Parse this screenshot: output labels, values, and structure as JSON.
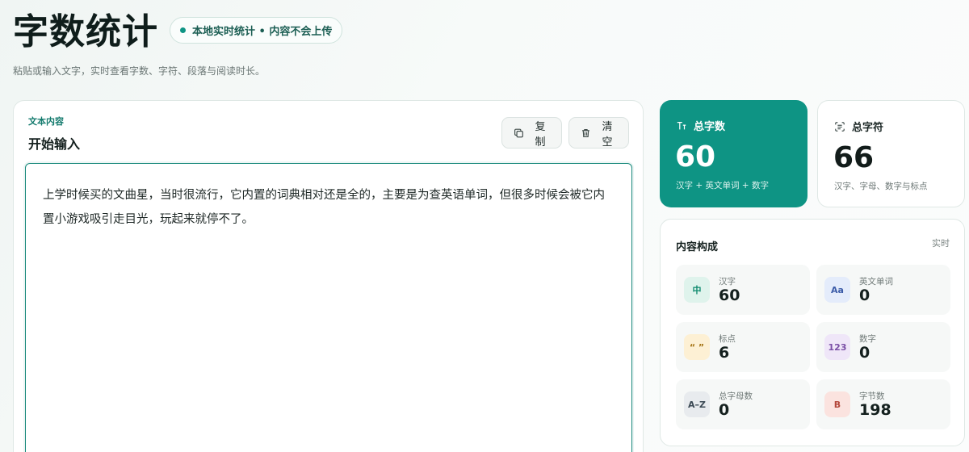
{
  "header": {
    "title": "字数统计",
    "badge": "本地实时统计 • 内容不会上传",
    "subtitle": "粘贴或输入文字，实时查看字数、字符、段落与阅读时长。"
  },
  "editor": {
    "eyebrow": "文本内容",
    "heading": "开始输入",
    "copy_label": "复制",
    "clear_label": "清空",
    "text": "上学时候买的文曲星，当时很流行，它内置的词典相对还是全的，主要是为查英语单词，但很多时候会被它内置小游戏吸引走目光，玩起来就停不了。"
  },
  "stats": {
    "total_chars": {
      "label": "总字数",
      "value": "60",
      "desc": "汉字 + 英文单词 + 数字"
    },
    "total_symbols": {
      "label": "总字符",
      "value": "66",
      "desc": "汉字、字母、数字与标点"
    }
  },
  "composition": {
    "title": "内容构成",
    "live": "实时",
    "items": [
      {
        "icon_text": "中",
        "label": "汉字",
        "value": "60",
        "bg": "#dff3ec",
        "fg": "#0e8a6e"
      },
      {
        "icon_text": "Aa",
        "label": "英文单词",
        "value": "0",
        "bg": "#e4ecfb",
        "fg": "#3b5ba8"
      },
      {
        "icon_text": "“ ”",
        "label": "标点",
        "value": "6",
        "bg": "#fdf0d4",
        "fg": "#a57415"
      },
      {
        "icon_text": "123",
        "label": "数字",
        "value": "0",
        "bg": "#efe6f8",
        "fg": "#7a4ea6"
      },
      {
        "icon_text": "A–Z",
        "label": "总字母数",
        "value": "0",
        "bg": "#e8ebee",
        "fg": "#3c4a55"
      },
      {
        "icon_text": "B",
        "label": "字节数",
        "value": "198",
        "bg": "#fbe3df",
        "fg": "#b3473b"
      }
    ]
  },
  "colors": {
    "accent": "#0e9484"
  }
}
